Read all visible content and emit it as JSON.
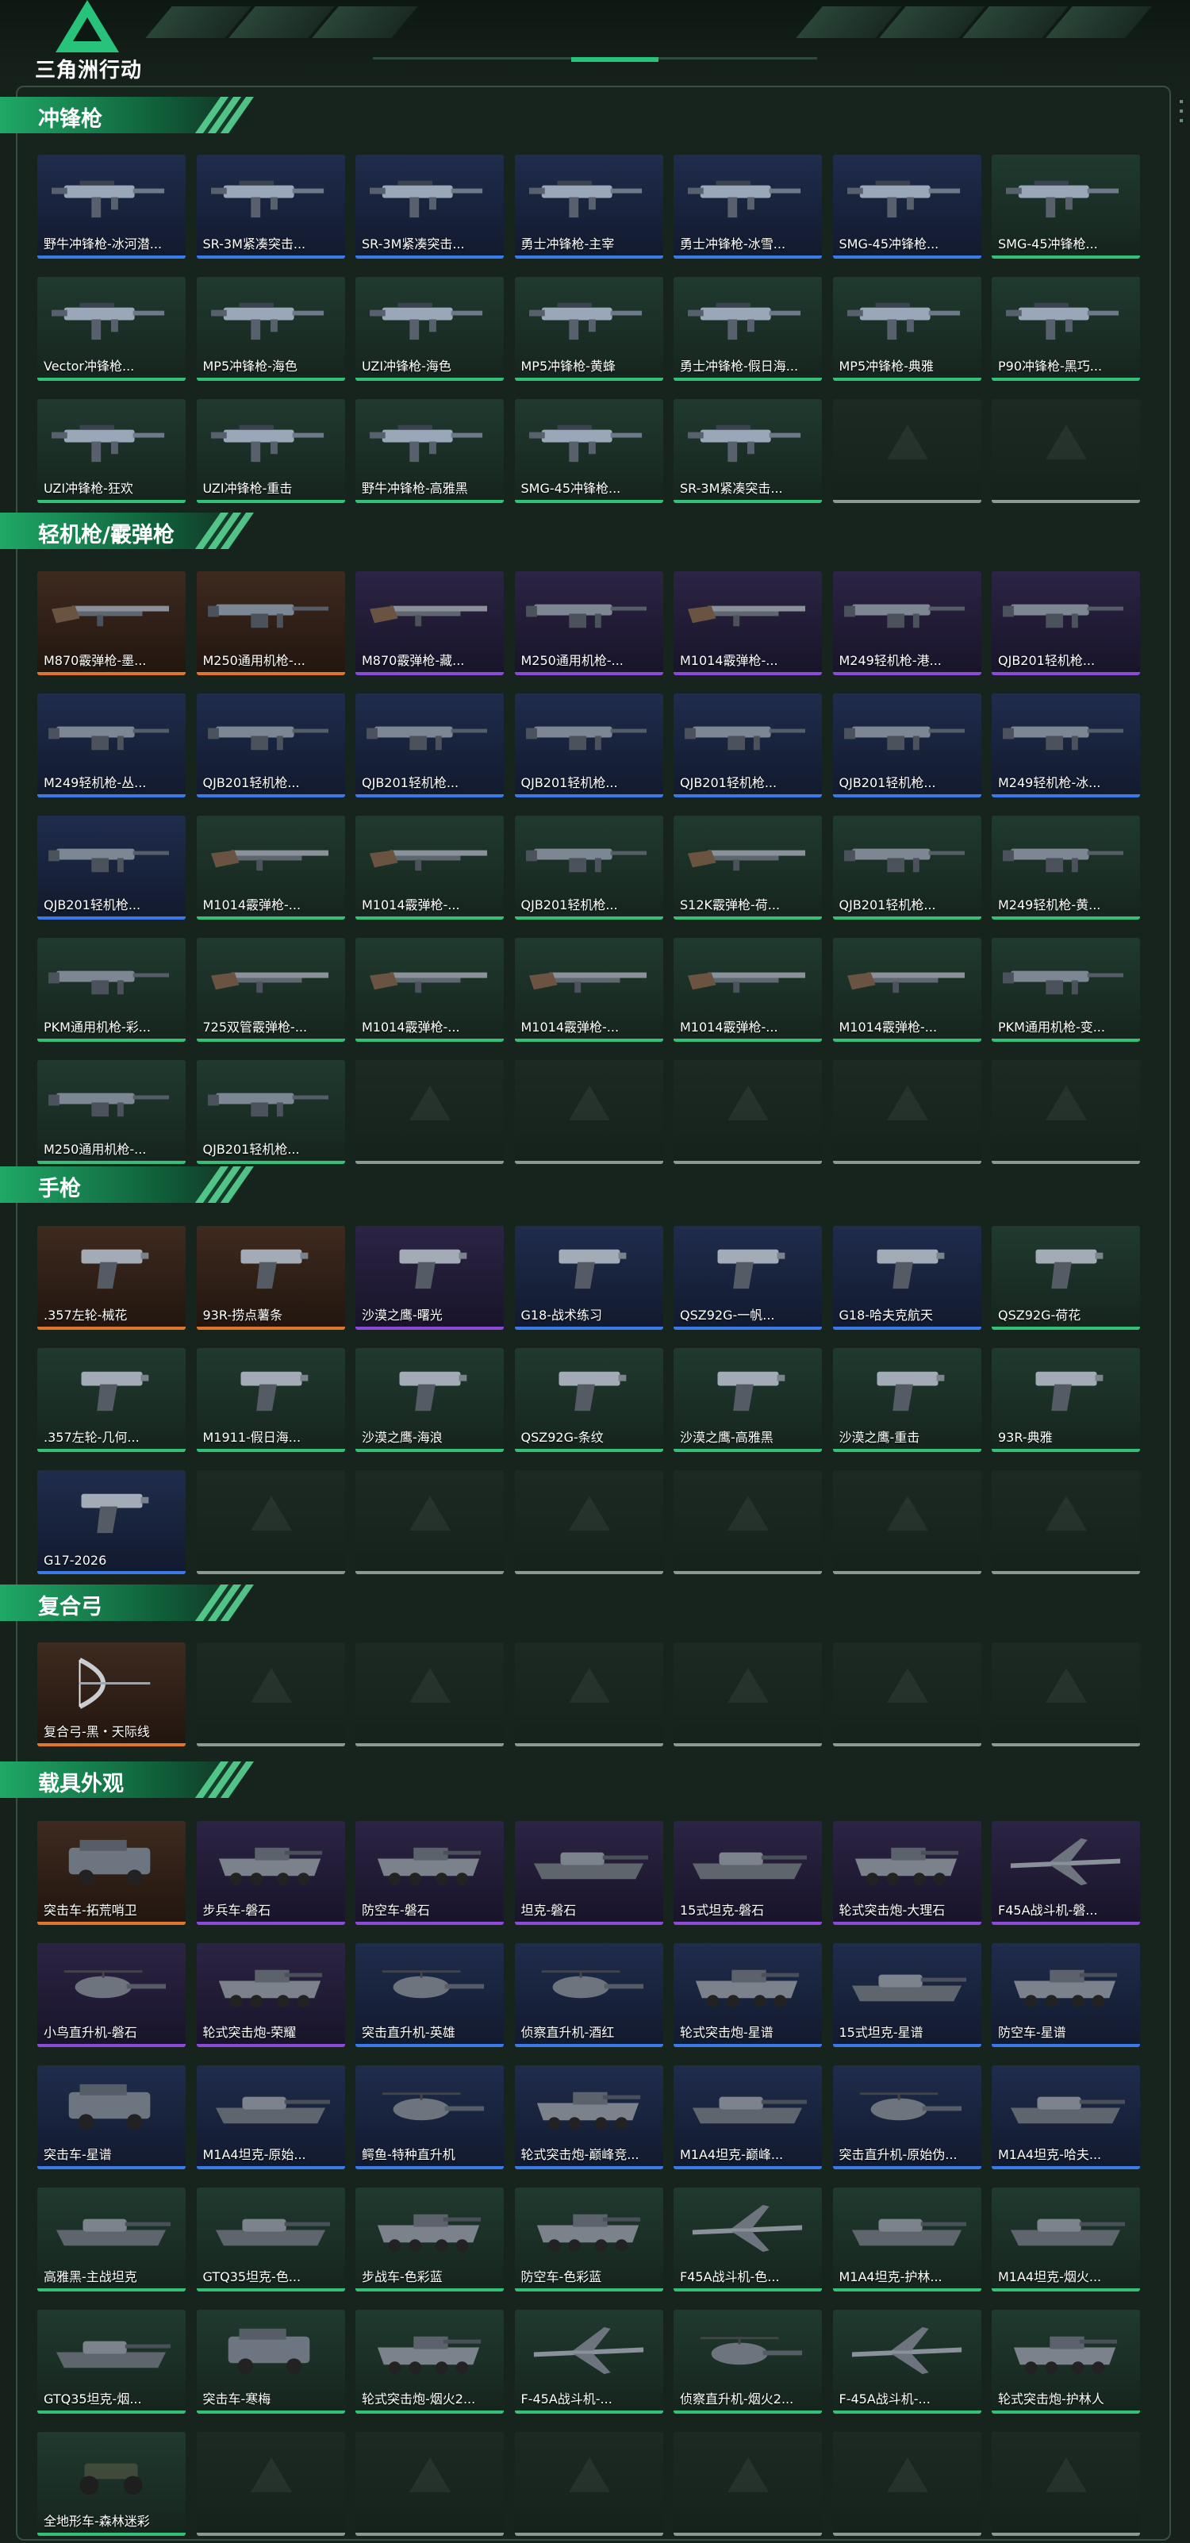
{
  "brand": {
    "logo_text": "三角洲行动",
    "accent": "#27c37a"
  },
  "colors": {
    "green": "#34c077",
    "orange": "#e0762e",
    "purple": "#8d4ad8",
    "blue": "#3a79e8",
    "empty": "#8b9991"
  },
  "sections": [
    {
      "title": "冲锋枪",
      "items": [
        {
          "label": "野牛冲锋枪-冰河潜...",
          "rarity": "blue",
          "icon": "weapon-smg"
        },
        {
          "label": "SR-3M紧凑突击...",
          "rarity": "blue",
          "icon": "weapon-smg"
        },
        {
          "label": "SR-3M紧凑突击...",
          "rarity": "blue",
          "icon": "weapon-smg"
        },
        {
          "label": "勇士冲锋枪-主宰",
          "rarity": "blue",
          "icon": "weapon-smg"
        },
        {
          "label": "勇士冲锋枪-冰雪...",
          "rarity": "blue",
          "icon": "weapon-smg"
        },
        {
          "label": "SMG-45冲锋枪...",
          "rarity": "blue",
          "icon": "weapon-smg"
        },
        {
          "label": "SMG-45冲锋枪...",
          "rarity": "green",
          "icon": "weapon-smg"
        },
        {
          "label": "Vector冲锋枪...",
          "rarity": "green",
          "icon": "weapon-smg"
        },
        {
          "label": "MP5冲锋枪-海色",
          "rarity": "green",
          "icon": "weapon-smg"
        },
        {
          "label": "UZI冲锋枪-海色",
          "rarity": "green",
          "icon": "weapon-smg"
        },
        {
          "label": "MP5冲锋枪-黄蜂",
          "rarity": "green",
          "icon": "weapon-smg"
        },
        {
          "label": "勇士冲锋枪-假日海...",
          "rarity": "green",
          "icon": "weapon-smg"
        },
        {
          "label": "MP5冲锋枪-典雅",
          "rarity": "green",
          "icon": "weapon-smg"
        },
        {
          "label": "P90冲锋枪-黑巧...",
          "rarity": "green",
          "icon": "weapon-smg"
        },
        {
          "label": "UZI冲锋枪-狂欢",
          "rarity": "green",
          "icon": "weapon-smg"
        },
        {
          "label": "UZI冲锋枪-重击",
          "rarity": "green",
          "icon": "weapon-smg"
        },
        {
          "label": "野牛冲锋枪-高雅黑",
          "rarity": "green",
          "icon": "weapon-smg"
        },
        {
          "label": "SMG-45冲锋枪...",
          "rarity": "green",
          "icon": "weapon-smg"
        },
        {
          "label": "SR-3M紧凑突击...",
          "rarity": "green",
          "icon": "weapon-smg"
        },
        {
          "label": "",
          "rarity": "empty"
        },
        {
          "label": "",
          "rarity": "empty"
        }
      ]
    },
    {
      "title": "轻机枪/霰弹枪",
      "items": [
        {
          "label": "M870霰弹枪-墨...",
          "rarity": "orange",
          "icon": "weapon-shotgun"
        },
        {
          "label": "M250通用机枪-...",
          "rarity": "orange",
          "icon": "weapon-lmg"
        },
        {
          "label": "M870霰弹枪-藏...",
          "rarity": "purple",
          "icon": "weapon-shotgun"
        },
        {
          "label": "M250通用机枪-...",
          "rarity": "purple",
          "icon": "weapon-lmg"
        },
        {
          "label": "M1014霰弹枪-...",
          "rarity": "purple",
          "icon": "weapon-shotgun"
        },
        {
          "label": "M249轻机枪-港...",
          "rarity": "purple",
          "icon": "weapon-lmg"
        },
        {
          "label": "QJB201轻机枪...",
          "rarity": "purple",
          "icon": "weapon-lmg"
        },
        {
          "label": "M249轻机枪-丛...",
          "rarity": "blue",
          "icon": "weapon-lmg"
        },
        {
          "label": "QJB201轻机枪...",
          "rarity": "blue",
          "icon": "weapon-lmg"
        },
        {
          "label": "QJB201轻机枪...",
          "rarity": "blue",
          "icon": "weapon-lmg"
        },
        {
          "label": "QJB201轻机枪...",
          "rarity": "blue",
          "icon": "weapon-lmg"
        },
        {
          "label": "QJB201轻机枪...",
          "rarity": "blue",
          "icon": "weapon-lmg"
        },
        {
          "label": "QJB201轻机枪...",
          "rarity": "blue",
          "icon": "weapon-lmg"
        },
        {
          "label": "M249轻机枪-冰...",
          "rarity": "blue",
          "icon": "weapon-lmg"
        },
        {
          "label": "QJB201轻机枪...",
          "rarity": "blue",
          "icon": "weapon-lmg"
        },
        {
          "label": "M1014霰弹枪-...",
          "rarity": "green",
          "icon": "weapon-shotgun"
        },
        {
          "label": "M1014霰弹枪-...",
          "rarity": "green",
          "icon": "weapon-shotgun"
        },
        {
          "label": "QJB201轻机枪...",
          "rarity": "green",
          "icon": "weapon-lmg"
        },
        {
          "label": "S12K霰弹枪-荷...",
          "rarity": "green",
          "icon": "weapon-shotgun"
        },
        {
          "label": "QJB201轻机枪...",
          "rarity": "green",
          "icon": "weapon-lmg"
        },
        {
          "label": "M249轻机枪-黄...",
          "rarity": "green",
          "icon": "weapon-lmg"
        },
        {
          "label": "PKM通用机枪-彩...",
          "rarity": "green",
          "icon": "weapon-lmg"
        },
        {
          "label": "725双管霰弹枪-...",
          "rarity": "green",
          "icon": "weapon-shotgun"
        },
        {
          "label": "M1014霰弹枪-...",
          "rarity": "green",
          "icon": "weapon-shotgun"
        },
        {
          "label": "M1014霰弹枪-...",
          "rarity": "green",
          "icon": "weapon-shotgun"
        },
        {
          "label": "M1014霰弹枪-...",
          "rarity": "green",
          "icon": "weapon-shotgun"
        },
        {
          "label": "M1014霰弹枪-...",
          "rarity": "green",
          "icon": "weapon-shotgun"
        },
        {
          "label": "PKM通用机枪-变...",
          "rarity": "green",
          "icon": "weapon-lmg"
        },
        {
          "label": "M250通用机枪-...",
          "rarity": "green",
          "icon": "weapon-lmg"
        },
        {
          "label": "QJB201轻机枪...",
          "rarity": "green",
          "icon": "weapon-lmg"
        },
        {
          "label": "",
          "rarity": "empty"
        },
        {
          "label": "",
          "rarity": "empty"
        },
        {
          "label": "",
          "rarity": "empty"
        },
        {
          "label": "",
          "rarity": "empty"
        },
        {
          "label": "",
          "rarity": "empty"
        }
      ]
    },
    {
      "title": "手枪",
      "items": [
        {
          "label": ".357左轮-械花",
          "rarity": "orange",
          "icon": "weapon-pistol"
        },
        {
          "label": "93R-捞点薯条",
          "rarity": "orange",
          "icon": "weapon-pistol"
        },
        {
          "label": "沙漠之鹰-曙光",
          "rarity": "purple",
          "icon": "weapon-pistol"
        },
        {
          "label": "G18-战术练习",
          "rarity": "blue",
          "icon": "weapon-pistol"
        },
        {
          "label": "QSZ92G-一帆...",
          "rarity": "blue",
          "icon": "weapon-pistol"
        },
        {
          "label": "G18-哈夫克航天",
          "rarity": "blue",
          "icon": "weapon-pistol"
        },
        {
          "label": "QSZ92G-荷花",
          "rarity": "green",
          "icon": "weapon-pistol"
        },
        {
          "label": ".357左轮-几何...",
          "rarity": "green",
          "icon": "weapon-pistol"
        },
        {
          "label": "M1911-假日海...",
          "rarity": "green",
          "icon": "weapon-pistol"
        },
        {
          "label": "沙漠之鹰-海浪",
          "rarity": "green",
          "icon": "weapon-pistol"
        },
        {
          "label": "QSZ92G-条纹",
          "rarity": "green",
          "icon": "weapon-pistol"
        },
        {
          "label": "沙漠之鹰-高雅黑",
          "rarity": "green",
          "icon": "weapon-pistol"
        },
        {
          "label": "沙漠之鹰-重击",
          "rarity": "green",
          "icon": "weapon-pistol"
        },
        {
          "label": "93R-典雅",
          "rarity": "green",
          "icon": "weapon-pistol"
        },
        {
          "label": "G17-2026",
          "rarity": "blue",
          "icon": "weapon-pistol"
        },
        {
          "label": "",
          "rarity": "empty"
        },
        {
          "label": "",
          "rarity": "empty"
        },
        {
          "label": "",
          "rarity": "empty"
        },
        {
          "label": "",
          "rarity": "empty"
        },
        {
          "label": "",
          "rarity": "empty"
        },
        {
          "label": "",
          "rarity": "empty"
        }
      ]
    },
    {
      "title": "复合弓",
      "items": [
        {
          "label": "复合弓-黑・天际线",
          "rarity": "orange",
          "icon": "weapon-bow"
        },
        {
          "label": "",
          "rarity": "empty"
        },
        {
          "label": "",
          "rarity": "empty"
        },
        {
          "label": "",
          "rarity": "empty"
        },
        {
          "label": "",
          "rarity": "empty"
        },
        {
          "label": "",
          "rarity": "empty"
        },
        {
          "label": "",
          "rarity": "empty"
        }
      ]
    },
    {
      "title": "载具外观",
      "items": [
        {
          "label": "突击车-拓荒哨卫",
          "rarity": "orange",
          "icon": "vehicle-truck"
        },
        {
          "label": "步兵车-磐石",
          "rarity": "purple",
          "icon": "vehicle-apc"
        },
        {
          "label": "防空车-磐石",
          "rarity": "purple",
          "icon": "vehicle-apc"
        },
        {
          "label": "坦克-磐石",
          "rarity": "purple",
          "icon": "vehicle-tank"
        },
        {
          "label": "15式坦克-磐石",
          "rarity": "purple",
          "icon": "vehicle-tank"
        },
        {
          "label": "轮式突击炮-大理石",
          "rarity": "purple",
          "icon": "vehicle-apc"
        },
        {
          "label": "F45A战斗机-磐...",
          "rarity": "purple",
          "icon": "vehicle-jet"
        },
        {
          "label": "小鸟直升机-磐石",
          "rarity": "purple",
          "icon": "vehicle-heli"
        },
        {
          "label": "轮式突击炮-荣耀",
          "rarity": "purple",
          "icon": "vehicle-apc"
        },
        {
          "label": "突击直升机-英雄",
          "rarity": "blue",
          "icon": "vehicle-heli"
        },
        {
          "label": "侦察直升机-酒红",
          "rarity": "blue",
          "icon": "vehicle-heli"
        },
        {
          "label": "轮式突击炮-星谱",
          "rarity": "blue",
          "icon": "vehicle-apc"
        },
        {
          "label": "15式坦克-星谱",
          "rarity": "blue",
          "icon": "vehicle-tank"
        },
        {
          "label": "防空车-星谱",
          "rarity": "blue",
          "icon": "vehicle-apc"
        },
        {
          "label": "突击车-星谱",
          "rarity": "blue",
          "icon": "vehicle-truck"
        },
        {
          "label": "M1A4坦克-原始...",
          "rarity": "blue",
          "icon": "vehicle-tank"
        },
        {
          "label": "鳄鱼-特种直升机",
          "rarity": "blue",
          "icon": "vehicle-heli"
        },
        {
          "label": "轮式突击炮-巅峰竞...",
          "rarity": "blue",
          "icon": "vehicle-apc"
        },
        {
          "label": "M1A4坦克-巅峰...",
          "rarity": "blue",
          "icon": "vehicle-tank"
        },
        {
          "label": "突击直升机-原始伪...",
          "rarity": "blue",
          "icon": "vehicle-heli"
        },
        {
          "label": "M1A4坦克-哈夫...",
          "rarity": "blue",
          "icon": "vehicle-tank"
        },
        {
          "label": "高雅黑-主战坦克",
          "rarity": "green",
          "icon": "vehicle-tank"
        },
        {
          "label": "GTQ35坦克-色...",
          "rarity": "green",
          "icon": "vehicle-tank"
        },
        {
          "label": "步战车-色彩蓝",
          "rarity": "green",
          "icon": "vehicle-apc"
        },
        {
          "label": "防空车-色彩蓝",
          "rarity": "green",
          "icon": "vehicle-apc"
        },
        {
          "label": "F45A战斗机-色...",
          "rarity": "green",
          "icon": "vehicle-jet"
        },
        {
          "label": "M1A4坦克-护林...",
          "rarity": "green",
          "icon": "vehicle-tank"
        },
        {
          "label": "M1A4坦克-烟火...",
          "rarity": "green",
          "icon": "vehicle-tank"
        },
        {
          "label": "GTQ35坦克-烟...",
          "rarity": "green",
          "icon": "vehicle-tank"
        },
        {
          "label": "突击车-寒梅",
          "rarity": "green",
          "icon": "vehicle-truck"
        },
        {
          "label": "轮式突击炮-烟火2...",
          "rarity": "green",
          "icon": "vehicle-apc"
        },
        {
          "label": "F-45A战斗机-...",
          "rarity": "green",
          "icon": "vehicle-jet"
        },
        {
          "label": "侦察直升机-烟火2...",
          "rarity": "green",
          "icon": "vehicle-heli"
        },
        {
          "label": "F-45A战斗机-...",
          "rarity": "green",
          "icon": "vehicle-jet"
        },
        {
          "label": "轮式突击炮-护林人",
          "rarity": "green",
          "icon": "vehicle-apc"
        },
        {
          "label": "全地形车-森林迷彩",
          "rarity": "green",
          "icon": "vehicle-atv"
        },
        {
          "label": "",
          "rarity": "empty"
        },
        {
          "label": "",
          "rarity": "empty"
        },
        {
          "label": "",
          "rarity": "empty"
        },
        {
          "label": "",
          "rarity": "empty"
        },
        {
          "label": "",
          "rarity": "empty"
        },
        {
          "label": "",
          "rarity": "empty"
        }
      ]
    }
  ]
}
